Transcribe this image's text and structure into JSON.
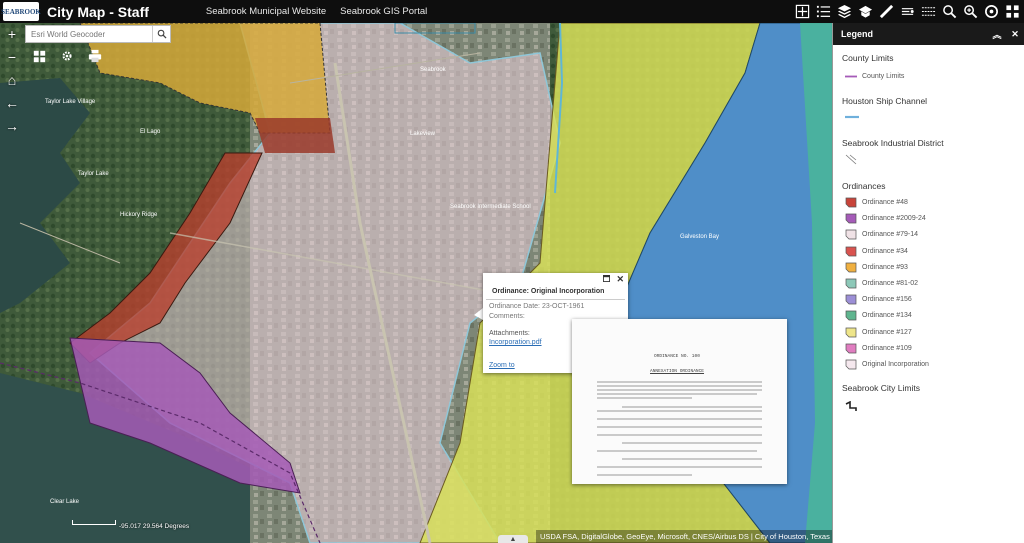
{
  "header": {
    "logo_text": "SEABROOK",
    "title": "City Map - Staff",
    "links": [
      "Seabrook Municipal Website",
      "Seabrook GIS Portal"
    ]
  },
  "toolbar": {
    "icons": [
      "map-icon",
      "list-icon",
      "layers-icon",
      "basemap-icon",
      "measure-icon",
      "draw-icon",
      "bookmark-icon",
      "zoom-icon",
      "about-icon",
      "print-icon"
    ]
  },
  "search": {
    "placeholder": "Esri World Geocoder"
  },
  "map_labels": [
    "Seabrook",
    "Taylor Lake",
    "Lakeview",
    "El Lago",
    "Taylor Lake Village",
    "Galveston Bay",
    "Clear Lake",
    "Hickory Ridge",
    "Seabrook Intermediate School"
  ],
  "popup": {
    "title": "Ordinance: Original Incorporation",
    "date_label": "Ordinance Date:",
    "date_value": "23-OCT-1961",
    "comments_label": "Comments:",
    "attachments_label": "Attachments:",
    "attachment_link": "Incorporation.pdf",
    "zoom_link": "Zoom to"
  },
  "document": {
    "heading": "ORDINANCE NO. 100",
    "subheading": "ANNEXATION ORDINANCE"
  },
  "status": {
    "coords": "-95.017 29.564 Degrees",
    "attribution": "USDA FSA, DigitalGlobe, GeoEye, Microsoft, CNES/Airbus DS | City of Houston, Texas Parks & W"
  },
  "legend": {
    "title": "Legend",
    "county_limits_title": "County Limits",
    "county_limits_item": "County Limits",
    "ship_channel_title": "Houston Ship Channel",
    "industrial_title": "Seabrook Industrial District",
    "ordinances_title": "Ordinances",
    "ordinances": [
      {
        "label": "Ordinance #48",
        "color": "#c8443a"
      },
      {
        "label": "Ordinance #2009-24",
        "color": "#a55bb8"
      },
      {
        "label": "Ordinance #79-14",
        "color": "#f0e2e6"
      },
      {
        "label": "Ordinance #34",
        "color": "#d9534f"
      },
      {
        "label": "Ordinance #93",
        "color": "#f0b040"
      },
      {
        "label": "Ordinance #81-02",
        "color": "#8dc8b8"
      },
      {
        "label": "Ordinance #156",
        "color": "#9c8fd6"
      },
      {
        "label": "Ordinance #134",
        "color": "#5fb58f"
      },
      {
        "label": "Ordinance #127",
        "color": "#eee58a"
      },
      {
        "label": "Ordinance #109",
        "color": "#e07dc0"
      },
      {
        "label": "Original Incorporation",
        "color": "#f5e8ee"
      }
    ],
    "city_limits_title": "Seabrook City Limits"
  }
}
